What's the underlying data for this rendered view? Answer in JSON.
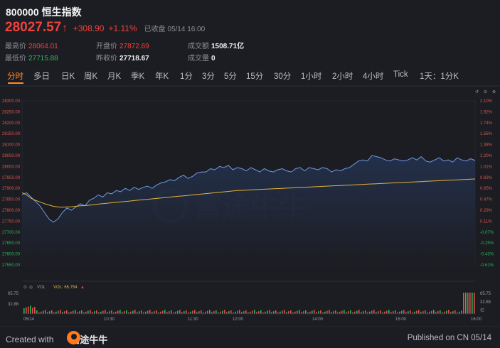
{
  "header": {
    "code": "800000",
    "name": "恒生指数"
  },
  "quote": {
    "price": "28027.57",
    "arrow": "↑",
    "change": "+308.90",
    "pct": "+1.11%",
    "status": "已收盘 05/14 16:00"
  },
  "stats": {
    "high_label": "最高价",
    "high": "28064.01",
    "low_label": "最低价",
    "low": "27715.88",
    "open_label": "开盘价",
    "open": "27872.69",
    "prev_label": "昨收价",
    "prev": "27718.67",
    "amount_label": "成交额",
    "amount": "1508.71亿",
    "volume_label": "成交量",
    "volume": "0"
  },
  "tabs": [
    "分时",
    "多日",
    "日K",
    "周K",
    "月K",
    "季K",
    "年K",
    "1分",
    "3分",
    "5分",
    "15分",
    "30分",
    "1小时",
    "2小时",
    "4小时",
    "Tick",
    "1天：1分K"
  ],
  "active_tab": "分时",
  "price_axis": {
    "left": [
      "28300.00",
      "28250.00",
      "28200.00",
      "28150.00",
      "28100.00",
      "28050.00",
      "28000.00",
      "27950.00",
      "27900.00",
      "27850.00",
      "27800.00",
      "27750.00",
      "27700.00",
      "27650.00",
      "27600.00",
      "27550.00"
    ],
    "right": [
      "2.10%",
      "1.92%",
      "1.74%",
      "1.56%",
      "1.38%",
      "1.20%",
      "1.01%",
      "0.83%",
      "0.65%",
      "0.47%",
      "0.29%",
      "0.11%",
      "-0.07%",
      "-0.25%",
      "-0.43%",
      "-0.61%"
    ]
  },
  "vol_panel": {
    "label": "VOL",
    "value_label": "VOL: 65.754",
    "arrow": "▲",
    "left_ticks": [
      "65.75",
      "32.88"
    ],
    "right_ticks": [
      "65.75",
      "32.88",
      "亿"
    ]
  },
  "time_axis": [
    "05/14",
    "10:30",
    "11:30",
    "12:00",
    "14:00",
    "15:00",
    "16:00"
  ],
  "watermark": "富途牛牛",
  "footer": {
    "created": "Created with",
    "brand": "富途牛牛",
    "published": "Published on CN 05/14"
  },
  "chart_data": {
    "type": "line",
    "ylim": [
      27550,
      28300
    ],
    "x": [
      "09:30",
      "09:33",
      "09:36",
      "09:39",
      "09:42",
      "09:45",
      "09:48",
      "09:51",
      "09:54",
      "09:57",
      "10:00",
      "10:03",
      "10:06",
      "10:09",
      "10:12",
      "10:15",
      "10:18",
      "10:21",
      "10:24",
      "10:27",
      "10:30",
      "10:33",
      "10:36",
      "10:39",
      "10:42",
      "10:45",
      "10:48",
      "10:51",
      "10:54",
      "10:57",
      "11:00",
      "11:03",
      "11:06",
      "11:09",
      "11:12",
      "11:15",
      "11:18",
      "11:21",
      "11:24",
      "11:27",
      "11:30",
      "13:00",
      "13:03",
      "13:06",
      "13:09",
      "13:12",
      "13:15",
      "13:18",
      "13:21",
      "13:24",
      "13:27",
      "13:30",
      "13:33",
      "13:36",
      "13:39",
      "13:42",
      "13:45",
      "13:48",
      "13:51",
      "13:54",
      "13:57",
      "14:00",
      "14:03",
      "14:06",
      "14:09",
      "14:12",
      "14:15",
      "14:18",
      "14:21",
      "14:24",
      "14:27",
      "14:30",
      "14:33",
      "14:36",
      "14:39",
      "14:42",
      "14:45",
      "14:48",
      "14:51",
      "14:54",
      "14:57",
      "15:00",
      "15:03",
      "15:06",
      "15:09",
      "15:12",
      "15:15",
      "15:18",
      "15:21",
      "15:24",
      "15:27",
      "15:30",
      "15:33",
      "15:36",
      "15:39",
      "15:42",
      "15:45",
      "15:48",
      "15:51",
      "15:54",
      "15:57",
      "16:00"
    ],
    "series": [
      {
        "values": [
          27872,
          27880,
          27860,
          27840,
          27820,
          27790,
          27760,
          27745,
          27760,
          27790,
          27810,
          27800,
          27815,
          27830,
          27820,
          27845,
          27855,
          27870,
          27860,
          27880,
          27875,
          27890,
          27885,
          27900,
          27890,
          27905,
          27895,
          27905,
          27910,
          27900,
          27915,
          27925,
          27930,
          27940,
          27935,
          27950,
          27960,
          27945,
          27955,
          27970,
          27975,
          27975,
          27990,
          27985,
          28000,
          27995,
          28005,
          27985,
          27995,
          27990,
          27980,
          27995,
          27985,
          27975,
          27990,
          27980,
          27975,
          27985,
          27990,
          27980,
          27975,
          27990,
          27995,
          27980,
          27995,
          27990,
          27985,
          27995,
          27990,
          27975,
          27985,
          27980,
          27990,
          27995,
          28010,
          28025,
          28030,
          28025,
          28050,
          28045,
          28040,
          28030,
          28025,
          28035,
          28030,
          28025,
          28030,
          28040,
          28030,
          28045,
          28025,
          28020,
          28030,
          28040,
          28025,
          28030,
          28020,
          28040,
          28030,
          28025,
          28035,
          28027.57
        ]
      },
      {
        "values": [
          27880,
          27870,
          27855,
          27845,
          27838,
          27830,
          27824,
          27818,
          27815,
          27814,
          27815,
          27816,
          27818,
          27820,
          27821,
          27823,
          27825,
          27828,
          27830,
          27832,
          27834,
          27836,
          27838,
          27840,
          27842,
          27844,
          27846,
          27848,
          27850,
          27852,
          27854,
          27856,
          27858,
          27860,
          27862,
          27864,
          27866,
          27868,
          27870,
          27872,
          27874,
          27876,
          27878,
          27880,
          27882,
          27884,
          27886,
          27888,
          27890,
          27891,
          27892,
          27893,
          27894,
          27895,
          27896,
          27897,
          27898,
          27899,
          27900,
          27901,
          27902,
          27903,
          27904,
          27905,
          27906,
          27907,
          27908,
          27909,
          27910,
          27911,
          27912,
          27913,
          27914,
          27915,
          27916,
          27917,
          27918,
          27919,
          27920,
          27921,
          27922,
          27923,
          27924,
          27925,
          27926,
          27927,
          27928,
          27929,
          27930,
          27931,
          27932,
          27933,
          27934,
          27935,
          27936,
          27937,
          27938,
          27939,
          27940,
          27941,
          27942,
          27943
        ]
      }
    ],
    "colors": {
      "line": "#6f9ae3",
      "avg": "#e3b23c",
      "area_top": "#24324f",
      "area_bottom": "#1c1d22",
      "up": "#f0413c",
      "down": "#28b954"
    }
  }
}
